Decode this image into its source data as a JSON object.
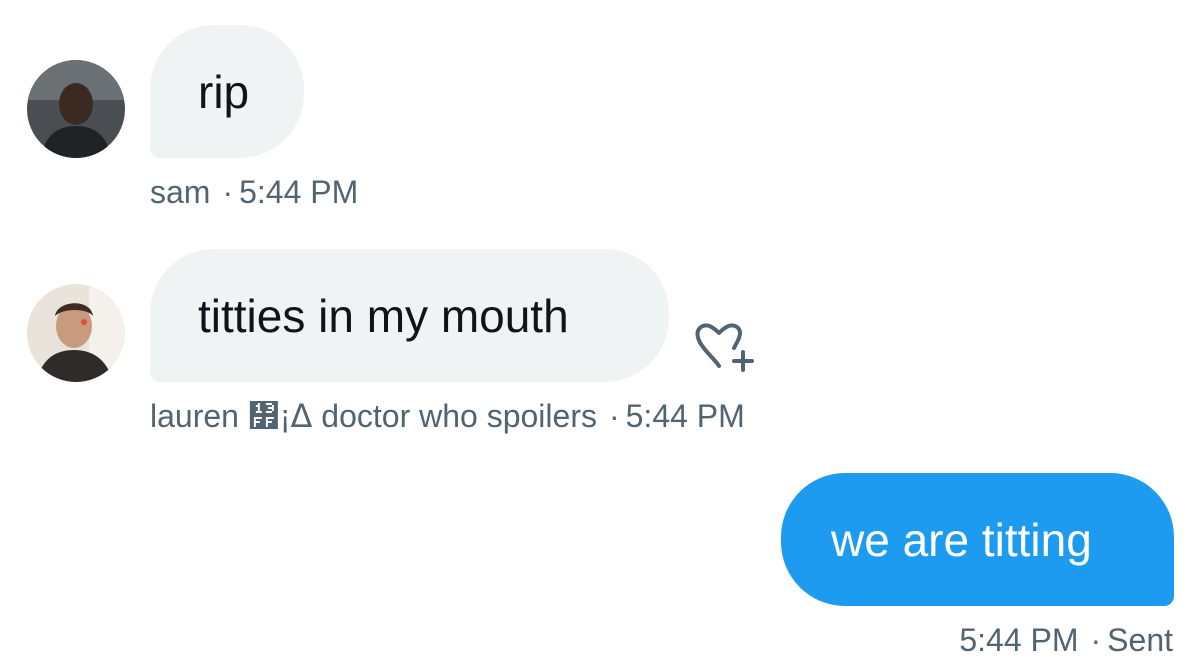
{
  "messages": [
    {
      "sender": "sam",
      "text": "rip",
      "time": "5:44 PM",
      "direction": "incoming",
      "avatar": "man-portrait-avatar"
    },
    {
      "sender": "lauren ᏿¡ᐃ doctor who spoilers",
      "text": "titties in my mouth",
      "time": "5:44 PM",
      "direction": "incoming",
      "avatar": "man-smiling-avatar",
      "reaction_icon": "heart-plus-icon"
    },
    {
      "text": "we are titting",
      "time": "5:44 PM",
      "status": "Sent",
      "direction": "outgoing"
    }
  ],
  "separator": "·",
  "colors": {
    "incoming_bubble": "#eff3f4",
    "outgoing_bubble": "#1d9bf0",
    "meta_text": "#536471",
    "message_text": "#0f1419"
  }
}
